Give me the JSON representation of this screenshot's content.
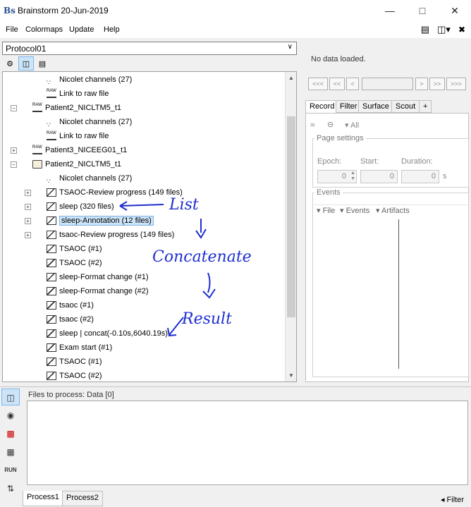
{
  "window": {
    "title": "Brainstorm 20-Jun-2019",
    "logo": "Bs",
    "minimize_icon": "minimize-icon",
    "maximize_icon": "maximize-icon",
    "close_icon": "close-icon"
  },
  "menu": {
    "items": [
      "File",
      "Colormaps",
      "Update",
      "Help"
    ]
  },
  "protocol": {
    "selected": "Protocol01"
  },
  "tree": {
    "rows": [
      {
        "label": "Nicolet channels (27)",
        "icon": "channel-icon",
        "level": 3,
        "expander": ""
      },
      {
        "label": "Link to raw file",
        "icon": "raw-link-icon",
        "level": 3,
        "expander": ""
      },
      {
        "label": "Patient2_NICLTM5_t1",
        "icon": "raw-folder-icon",
        "level": 2,
        "expander": "−"
      },
      {
        "label": "Nicolet channels (27)",
        "icon": "channel-icon",
        "level": 3,
        "expander": ""
      },
      {
        "label": "Link to raw file",
        "icon": "raw-link-icon",
        "level": 3,
        "expander": ""
      },
      {
        "label": "Patient3_NICEEG01_t1",
        "icon": "raw-folder-icon",
        "level": 2,
        "expander": "+"
      },
      {
        "label": "Patient2_NICLTM5_t1",
        "icon": "folder-open-icon",
        "level": 2,
        "expander": "−"
      },
      {
        "label": "Nicolet channels (27)",
        "icon": "channel-icon",
        "level": 3,
        "expander": ""
      },
      {
        "label": "TSAOC-Review progress (149 files)",
        "icon": "data-list-icon",
        "level": 3,
        "expander": "+"
      },
      {
        "label": "sleep (320 files)",
        "icon": "data-list-icon",
        "level": 3,
        "expander": "+"
      },
      {
        "label": "sleep-Annotation (12 files)",
        "icon": "data-list-icon",
        "level": 3,
        "expander": "+",
        "selected": true
      },
      {
        "label": "tsaoc-Review progress (149 files)",
        "icon": "data-list-icon",
        "level": 3,
        "expander": "+"
      },
      {
        "label": "TSAOC (#1)",
        "icon": "data-icon",
        "level": 3,
        "expander": ""
      },
      {
        "label": "TSAOC (#2)",
        "icon": "data-icon",
        "level": 3,
        "expander": ""
      },
      {
        "label": "sleep-Format change (#1)",
        "icon": "data-icon",
        "level": 3,
        "expander": ""
      },
      {
        "label": "sleep-Format change (#2)",
        "icon": "data-icon",
        "level": 3,
        "expander": ""
      },
      {
        "label": "tsaoc (#1)",
        "icon": "data-icon",
        "level": 3,
        "expander": ""
      },
      {
        "label": "tsaoc (#2)",
        "icon": "data-icon",
        "level": 3,
        "expander": ""
      },
      {
        "label": "sleep | concat(-0.10s,6040.19s)",
        "icon": "data-icon",
        "level": 3,
        "expander": ""
      },
      {
        "label": "Exam start (#1)",
        "icon": "data-icon",
        "level": 3,
        "expander": ""
      },
      {
        "label": "TSAOC (#1)",
        "icon": "data-icon",
        "level": 3,
        "expander": ""
      },
      {
        "label": "TSAOC (#2)",
        "icon": "data-icon",
        "level": 3,
        "expander": ""
      }
    ]
  },
  "annotations": {
    "list": "List",
    "concatenate": "Concatenate",
    "result": "Result"
  },
  "right": {
    "status": "No data loaded.",
    "nav_buttons": [
      "<<<",
      "<<",
      "<",
      ">",
      ">>",
      ">>>"
    ],
    "tabs": [
      "Record",
      "Filter",
      "Surface",
      "Scout",
      "+"
    ],
    "active_tab": "Record",
    "toolbar_all": "All",
    "page_settings": {
      "title": "Page settings",
      "epoch_label": "Epoch:",
      "epoch_value": "0",
      "start_label": "Start:",
      "start_value": "0",
      "duration_label": "Duration:",
      "duration_value": "0",
      "duration_unit": "s"
    },
    "events": {
      "title": "Events",
      "menu": [
        "File",
        "Events",
        "Artifacts"
      ]
    }
  },
  "process": {
    "files_title": "Files to process: Data [0]",
    "tabs": [
      "Process1",
      "Process2"
    ],
    "filter_label": "Filter",
    "run_label": "RUN"
  }
}
